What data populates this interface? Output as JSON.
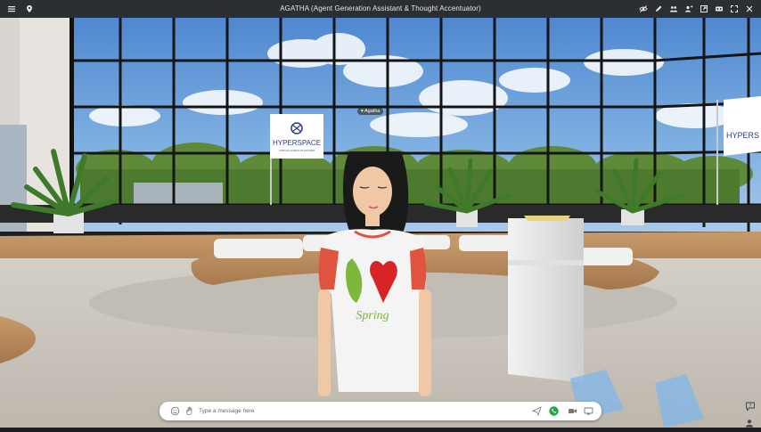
{
  "window": {
    "title": "AGATHA (Agent Generation Assistant & Thought Accentuator)"
  },
  "toolbar": {
    "left_icons": [
      "menu-icon",
      "location-pin-icon"
    ],
    "right_icons": [
      "visibility-icon",
      "edit-icon",
      "people-icon",
      "person-add-icon",
      "share-icon",
      "vr-headset-icon",
      "fullscreen-icon",
      "close-icon"
    ]
  },
  "scene": {
    "avatar_name": "Agatha",
    "banner_text": "HYPERSPACE",
    "banner_sub": "VIRTUAL EVENT PLATFORM",
    "right_banner_text": "HYPERS",
    "shirt_text": "Spring",
    "sky_color": "#5b93d6",
    "floor_color": "#c9c4bb"
  },
  "chat": {
    "placeholder": "Type a message here",
    "call_color": "#1fa84a"
  }
}
